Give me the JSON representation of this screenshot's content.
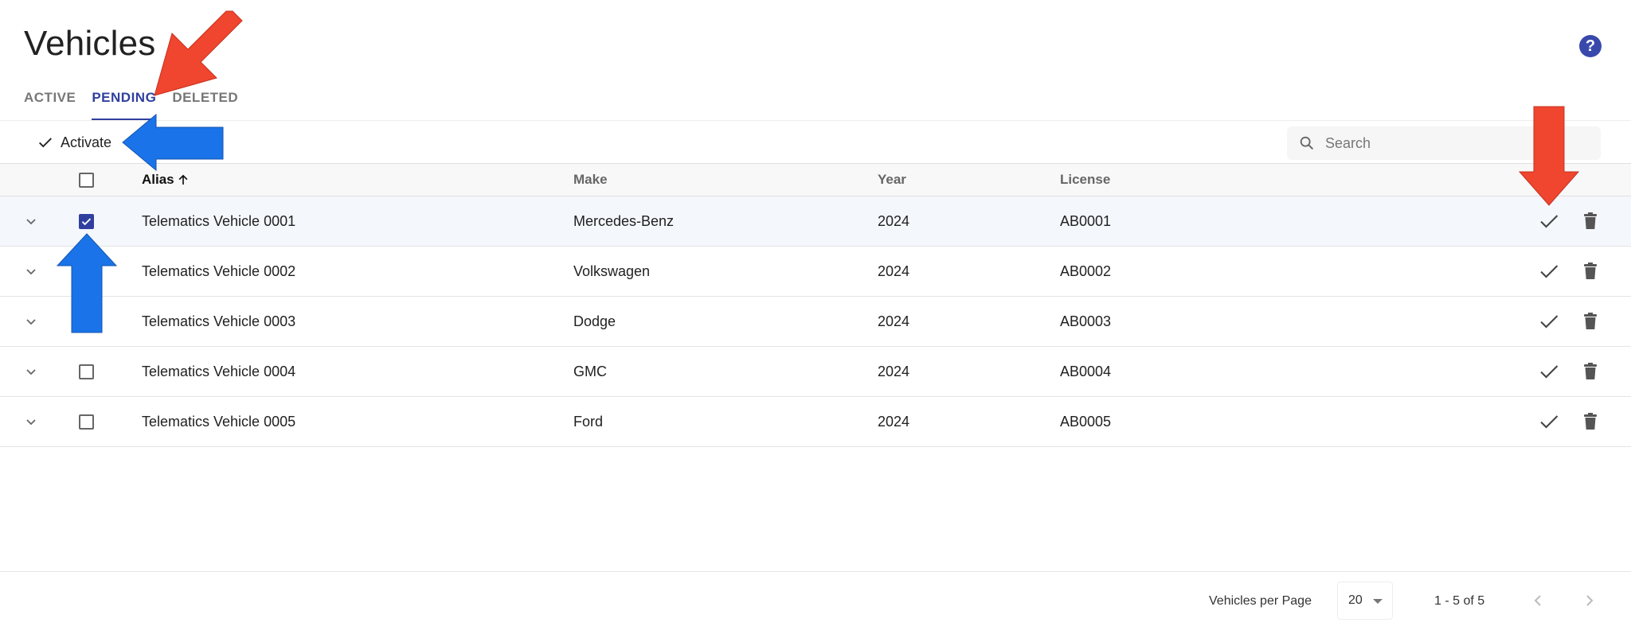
{
  "header": {
    "title": "Vehicles",
    "help_label": "?"
  },
  "tabs": [
    {
      "label": "ACTIVE",
      "active": false
    },
    {
      "label": "PENDING",
      "active": true
    },
    {
      "label": "DELETED",
      "active": false
    }
  ],
  "toolbar": {
    "activate_label": "Activate",
    "search_placeholder": "Search",
    "search_value": ""
  },
  "table": {
    "columns": [
      {
        "label": "Alias",
        "sorted": "ascending"
      },
      {
        "label": "Make"
      },
      {
        "label": "Year"
      },
      {
        "label": "License"
      }
    ],
    "rows": [
      {
        "alias": "Telematics Vehicle 0001",
        "make": "Mercedes-Benz",
        "year": "2024",
        "license": "AB0001",
        "checked": true
      },
      {
        "alias": "Telematics Vehicle 0002",
        "make": "Volkswagen",
        "year": "2024",
        "license": "AB0002",
        "checked": false
      },
      {
        "alias": "Telematics Vehicle 0003",
        "make": "Dodge",
        "year": "2024",
        "license": "AB0003",
        "checked": false
      },
      {
        "alias": "Telematics Vehicle 0004",
        "make": "GMC",
        "year": "2024",
        "license": "AB0004",
        "checked": false
      },
      {
        "alias": "Telematics Vehicle 0005",
        "make": "Ford",
        "year": "2024",
        "license": "AB0005",
        "checked": false
      }
    ]
  },
  "footer": {
    "per_page_label": "Vehicles per Page",
    "per_page_value": "20",
    "range_label": "1 - 5 of 5"
  },
  "icons": {
    "help": "help-circle-icon",
    "activate": "check-icon",
    "search": "search-icon",
    "sort": "arrow-up-icon",
    "expand": "chevron-down-icon",
    "row_activate": "check-icon",
    "row_delete": "trash-icon",
    "prev": "chevron-left-icon",
    "next": "chevron-right-icon"
  },
  "colors": {
    "accent": "#303f9f",
    "help_badge": "#3949ab",
    "selected_row": "#f4f7fc",
    "annotation_red": "#f0452e",
    "annotation_blue": "#1a73e8"
  }
}
